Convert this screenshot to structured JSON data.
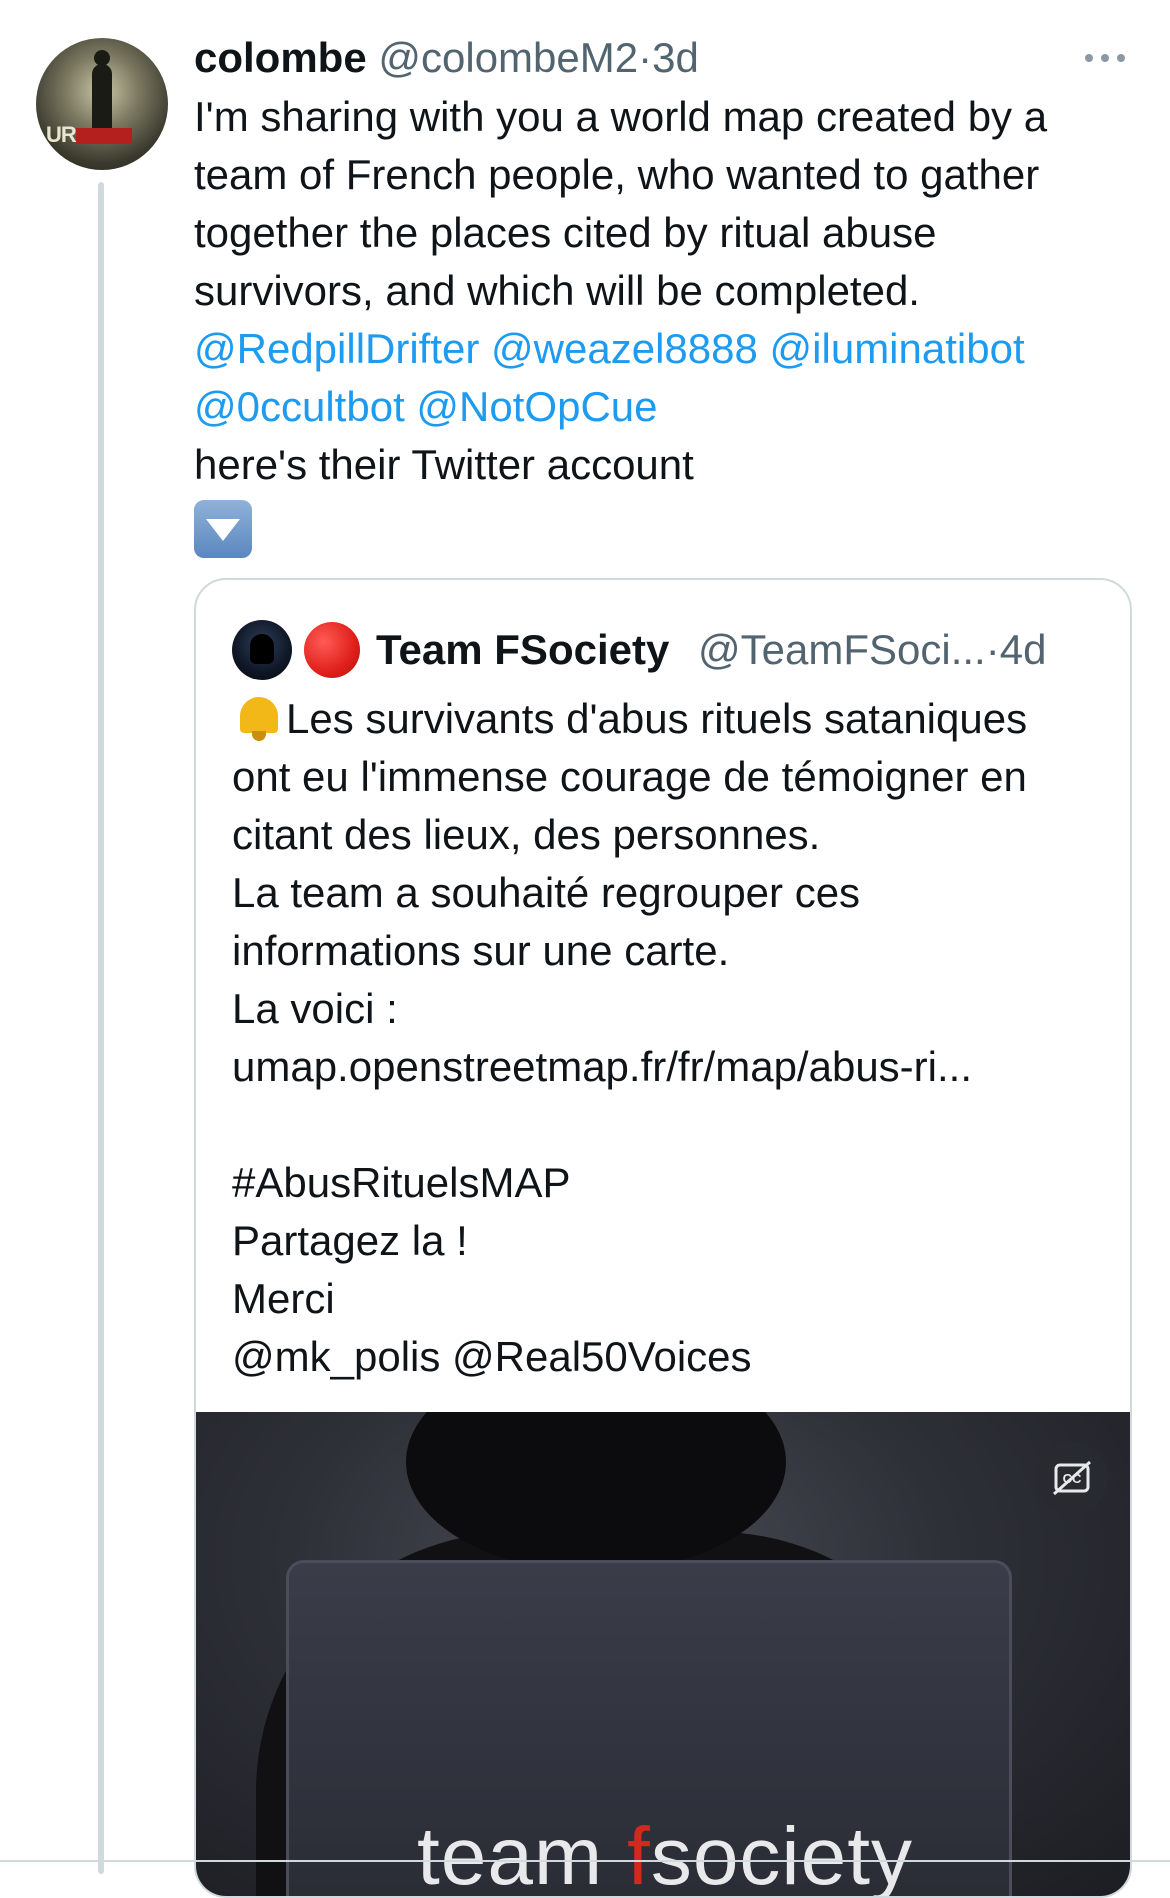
{
  "tweet": {
    "author_name": "colombe",
    "author_handle": "@colombeM2",
    "separator": "·",
    "time": "3d",
    "avatar_text": "UR",
    "text_lines": [
      "I'm sharing with you a world map created by a",
      "team of French people, who wanted to gather",
      "together the places cited by ritual abuse",
      "survivors, and which will be completed."
    ],
    "mentions_line1": [
      "@RedpillDrifter",
      "@weazel8888",
      "@iluminatibot"
    ],
    "mentions_line2": [
      "@0ccultbot",
      "@NotOpCue"
    ],
    "closing_line": "here's their Twitter account",
    "emoji": "down-arrow-button"
  },
  "quoted_tweet": {
    "author_name": "Team FSociety",
    "author_handle": "@TeamFSoci...",
    "separator": "·",
    "time": "4d",
    "name_emoji": "red-circle",
    "lines": [
      "Les survivants d'abus rituels sataniques",
      "ont eu l'immense courage de témoigner en",
      "citant des lieux, des personnes.",
      "La team a souhaité regrouper ces",
      "informations sur une carte.",
      "La voici :",
      "umap.openstreetmap.fr/fr/map/abus-ri...",
      "",
      "#AbusRituelsMAP",
      "Partagez la !",
      "Merci",
      "@mk_polis @Real50Voices"
    ],
    "media": {
      "brand_text_1": "team ",
      "brand_text_f": "f",
      "brand_text_2": "society"
    }
  },
  "colors": {
    "link": "#1d9bf0",
    "secondary_text": "#536471",
    "border": "#cfd9de",
    "brand_red": "#d1281f"
  }
}
